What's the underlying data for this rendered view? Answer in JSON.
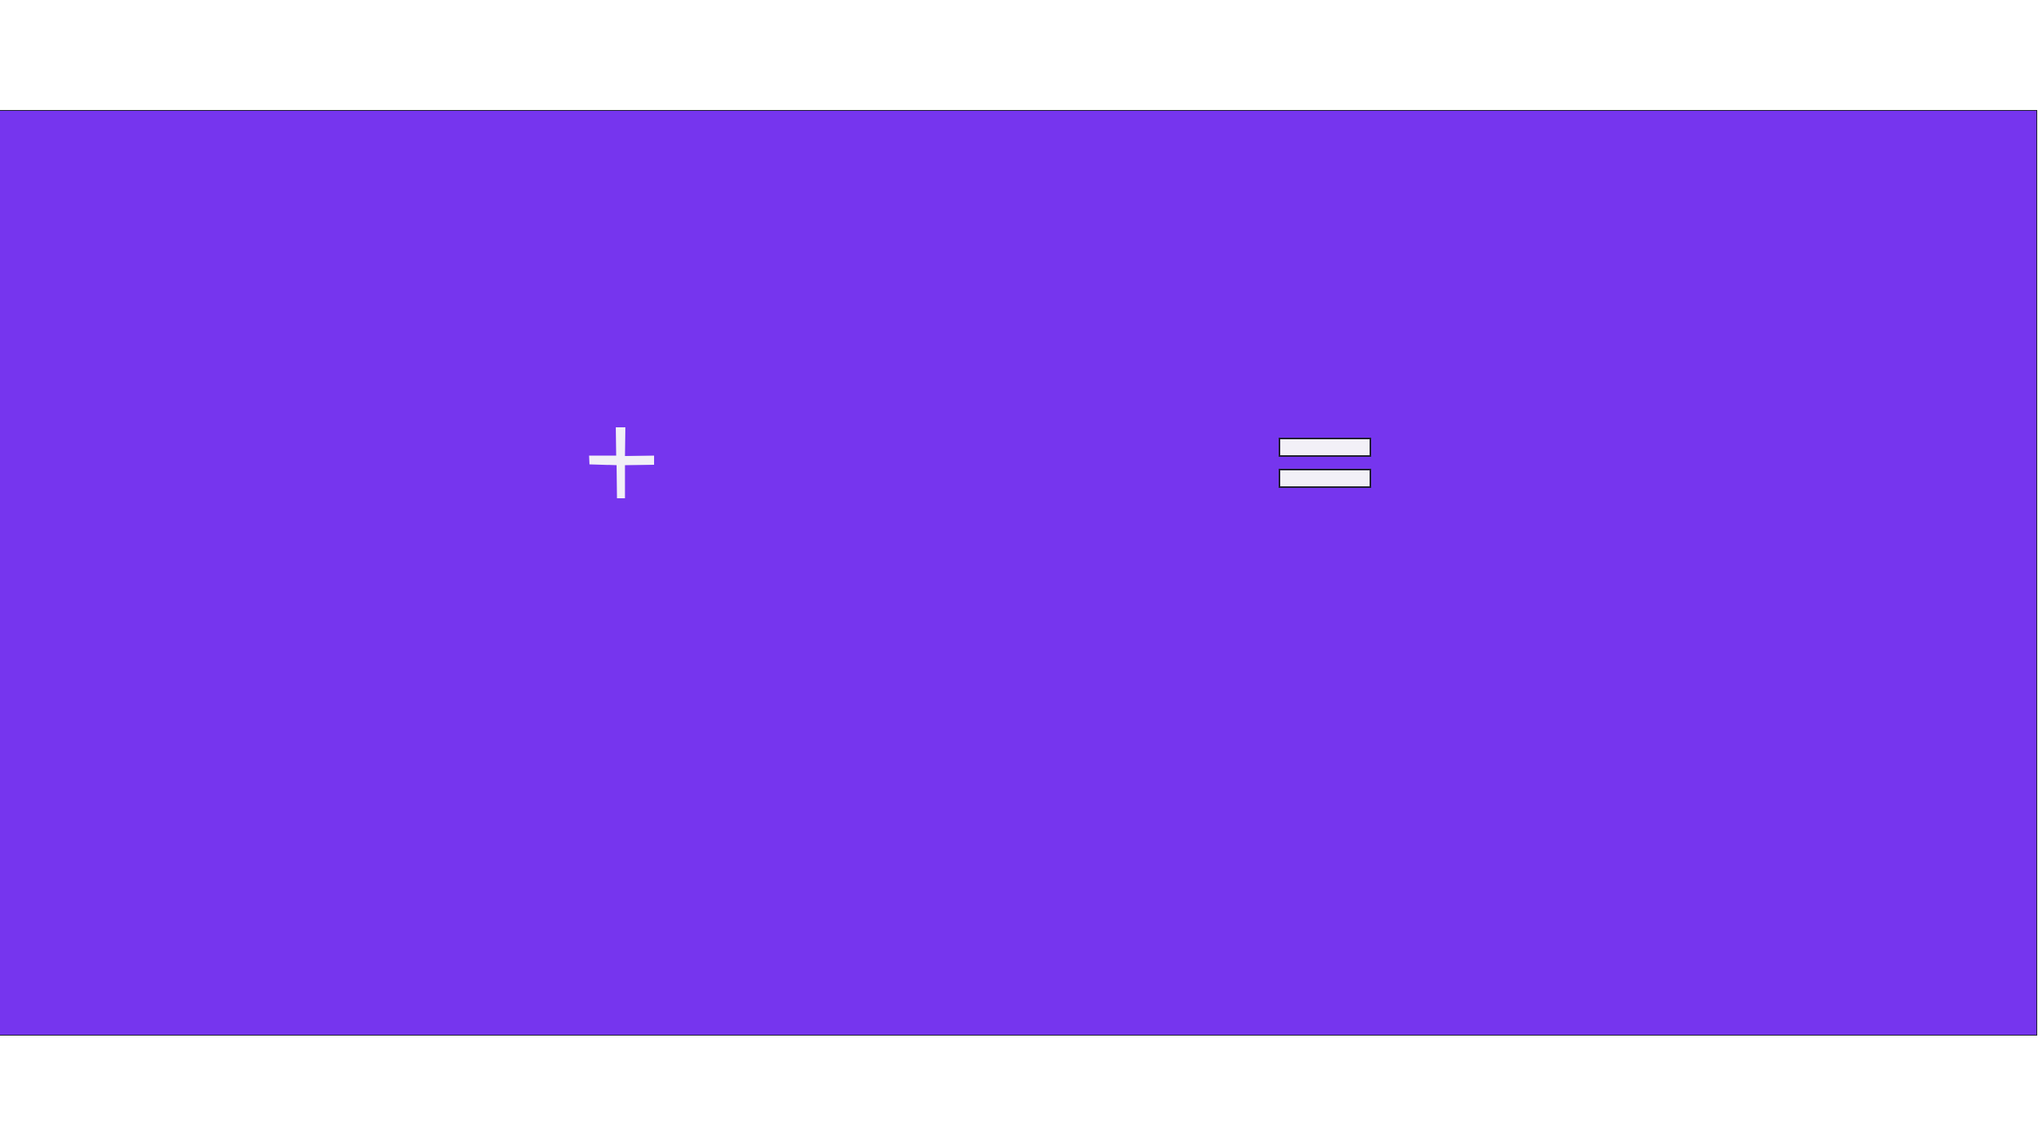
{
  "colors": {
    "banner_background": "#7635ee",
    "glyph_fill": "#f2f0f7",
    "outline": "#1f1f2e",
    "page_background": "#ffffff"
  },
  "icons": {
    "plus": "plus-icon",
    "equals": "equals-icon"
  }
}
